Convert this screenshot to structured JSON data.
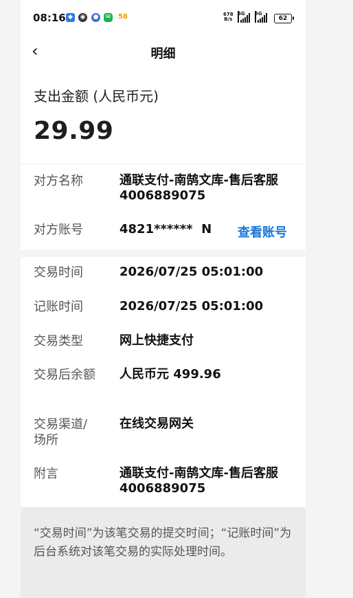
{
  "status_bar": {
    "time": "08:16",
    "notification_count": "58",
    "net_speed_value": "678",
    "net_speed_unit": "B/s",
    "signal_1_label": "5G",
    "signal_2_label": "5G",
    "battery_level": "62"
  },
  "header": {
    "title": "明细"
  },
  "summary": {
    "amount_label": "支出金额 (人民币元)",
    "amount": "29.99"
  },
  "counterparty": {
    "name_label": "对方名称",
    "name_value": "通联支付-南鹄文库-售后客服4006889075",
    "account_label": "对方账号",
    "account_value": "4821******  N",
    "view_account_link": "查看账号"
  },
  "details": {
    "trade_time_label": "交易时间",
    "trade_time_value": "2026/07/25 05:01:00",
    "post_time_label": "记账时间",
    "post_time_value": "2026/07/25 05:01:00",
    "trade_type_label": "交易类型",
    "trade_type_value": "网上快捷支付",
    "balance_label": "交易后余额",
    "balance_value": "人民币元 499.96",
    "channel_label": "交易渠道/场所",
    "channel_value": "在线交易网关",
    "remark_label": "附言",
    "remark_value": "通联支付-南鹄文库-售后客服4006889075"
  },
  "footnote": "“交易时间”为该笔交易的提交时间；“记账时间”为后台系统对该笔交易的实际处理时间。",
  "colors": {
    "link": "#1677d8",
    "page_background": "#f4f4f4",
    "card_background": "#ffffff"
  }
}
